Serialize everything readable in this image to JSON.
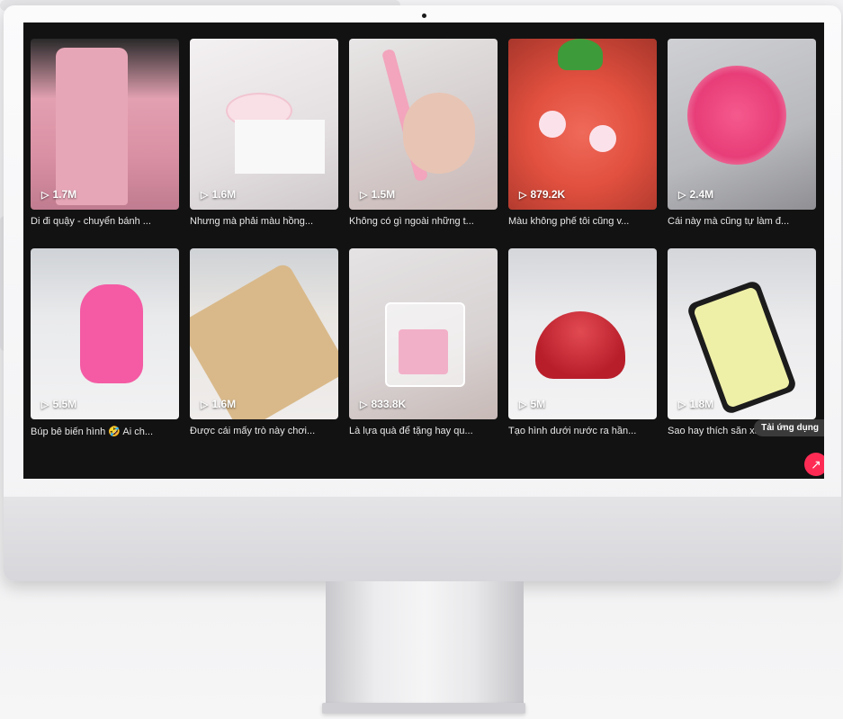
{
  "videos": [
    {
      "views": "1.7M",
      "caption": "Di đi quậy - chuyển bánh ..."
    },
    {
      "views": "1.6M",
      "caption": "Nhưng mà phải màu hồng..."
    },
    {
      "views": "1.5M",
      "caption": "Không có gì ngoài những t..."
    },
    {
      "views": "879.2K",
      "caption": "Màu không phế tôi cũng v..."
    },
    {
      "views": "2.4M",
      "caption": "Cái này mà cũng tự làm đ..."
    },
    {
      "views": "5.5M",
      "caption": "Búp bê biến hình 🤣 Ai ch..."
    },
    {
      "views": "1.6M",
      "caption": "Được cái mấy trò này chơi..."
    },
    {
      "views": "833.8K",
      "caption": "Là lựa quà để tặng hay qu..."
    },
    {
      "views": "5M",
      "caption": "Tạo hình dưới nước ra hần..."
    },
    {
      "views": "1.8M",
      "caption": "Sao hay thích săn xa-le q..."
    }
  ],
  "app_prompt": "Tải ứng dụng",
  "icons": {
    "play": "play-icon",
    "fab": "tiktok-share-icon"
  },
  "colors": {
    "screen_bg": "#121212",
    "accent": "#fe2c55"
  }
}
